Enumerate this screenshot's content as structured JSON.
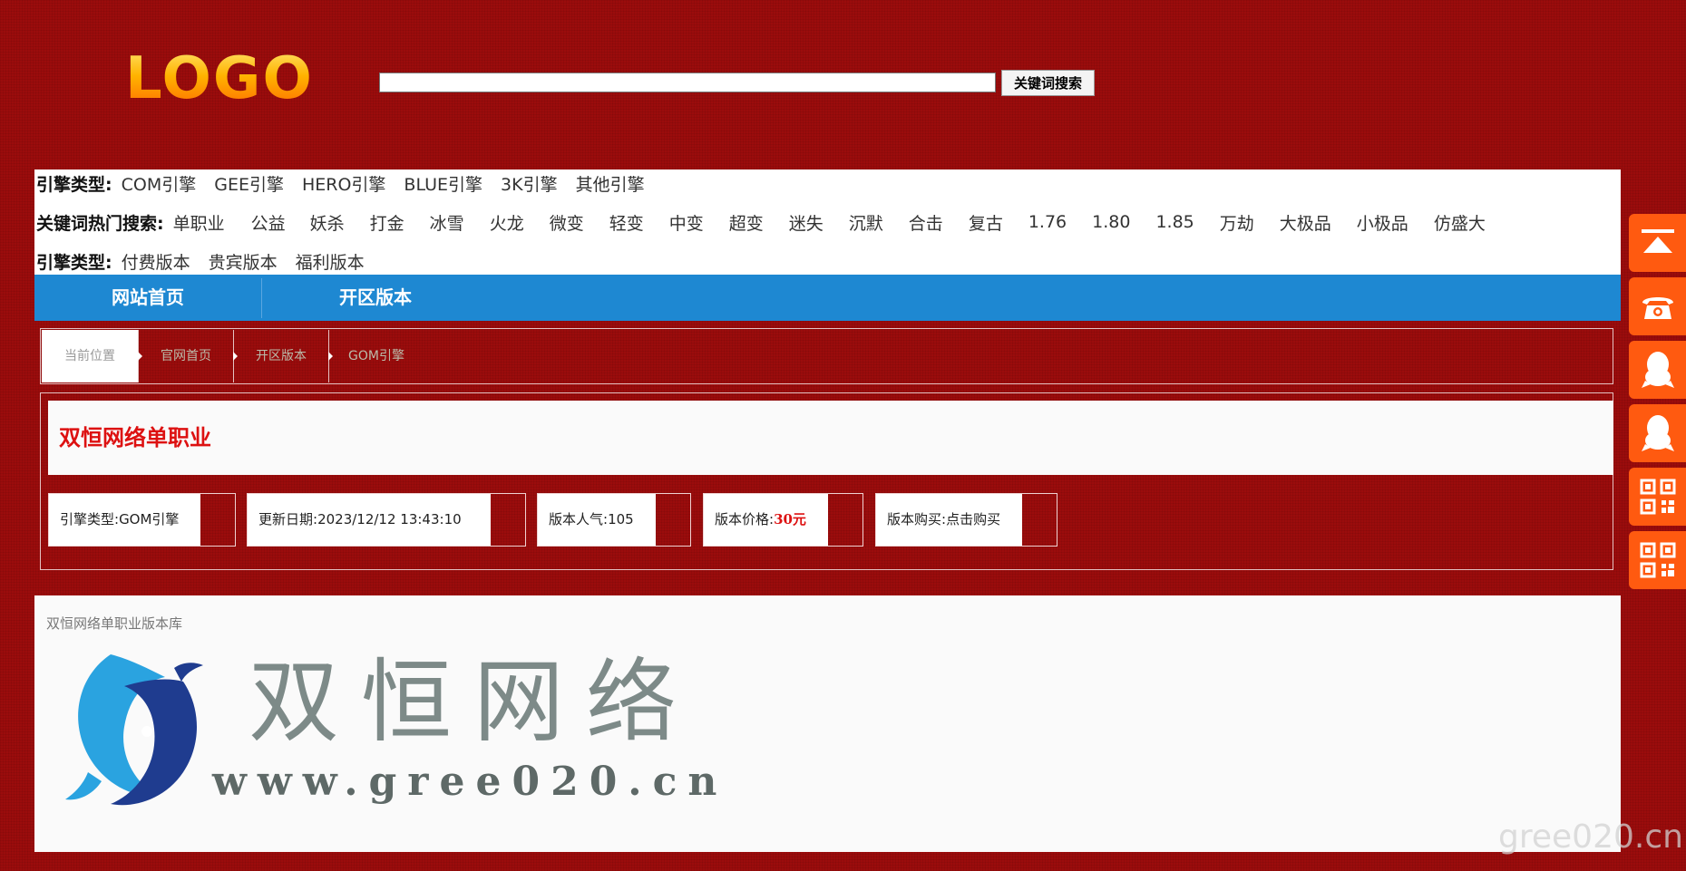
{
  "header": {
    "logo_text": "LOGO",
    "search_value": "",
    "search_button": "关键词搜索"
  },
  "filters": {
    "engine_label": "引擎类型:",
    "engines": [
      "COM引擎",
      "GEE引擎",
      "HERO引擎",
      "BLUE引擎",
      "3K引擎",
      "其他引擎"
    ],
    "hot_label": "关键词热门搜索:",
    "hot": [
      "单职业",
      "公益",
      "妖杀",
      "打金",
      "冰雪",
      "火龙",
      "微变",
      "轻变",
      "中变",
      "超变",
      "迷失",
      "沉默",
      "合击",
      "复古",
      "1.76",
      "1.80",
      "1.85",
      "万劫",
      "大极品",
      "小极品",
      "仿盛大"
    ],
    "type_label": "引擎类型:",
    "types": [
      "付费版本",
      "贵宾版本",
      "福利版本"
    ]
  },
  "nav": {
    "items": [
      "网站首页",
      "开区版本"
    ]
  },
  "breadcrumb": {
    "items": [
      "当前位置",
      "官网首页",
      "开区版本",
      "GOM引擎"
    ]
  },
  "detail": {
    "title": "双恒网络单职业",
    "engine_label": "引擎类型:",
    "engine_value": "GOM引擎",
    "date_label": "更新日期:",
    "date_value": "2023/12/12 13:43:10",
    "popularity_label": "版本人气:",
    "popularity_value": "105",
    "price_label": "版本价格:",
    "price_value": "30元",
    "buy_label": "版本购买:",
    "buy_value": "点击购买"
  },
  "content": {
    "heading": "双恒网络单职业版本库",
    "brand_cn": "双恒网络",
    "brand_url": "www.gree020.cn"
  },
  "watermark": "gree020.cn",
  "colors": {
    "background": "#9b0c0c",
    "nav": "#1e88d2",
    "accent_red": "#dd1111",
    "float_orange": "#ff5a10"
  },
  "float_icons": [
    "back-to-top-icon",
    "phone-icon",
    "qq-icon",
    "qq-icon",
    "qr-code-icon",
    "qr-code-icon"
  ]
}
